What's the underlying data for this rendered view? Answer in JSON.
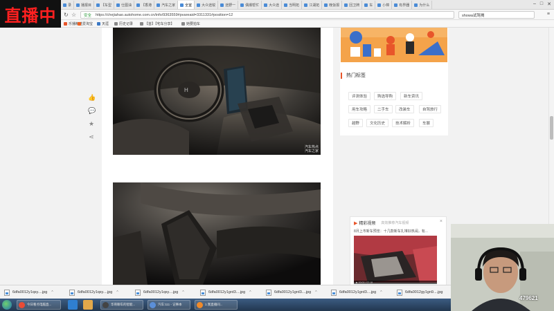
{
  "live_badge": "直播中",
  "browser": {
    "tabs": [
      "录",
      "播报目",
      "【车型",
      "仕图油",
      "【香港",
      "汽车之家",
      "全室",
      "大众途锐",
      "途野一",
      "偶爆帮忙",
      "大众途",
      "当明拓",
      "江湖拓",
      "晚饭报",
      "回卫牌",
      "车",
      "小棉",
      "有界器",
      "为什么"
    ],
    "active_tab_index": 6,
    "url": "https://chejiahao.autohome.com.cn/info/9363559#pvareaid=3311331#position=12",
    "secure_label": "安全",
    "search_text": "showa试驾揭",
    "bookmarks": [
      "乐播精选",
      "爱淘宝",
      "天涯",
      "历史记录",
      "【首】【宅车分享】",
      "她要拍车"
    ]
  },
  "share_rail": [
    {
      "icon": "thumbs-up-icon",
      "glyph": "👍"
    },
    {
      "icon": "comment-icon",
      "glyph": "💬"
    },
    {
      "icon": "star-icon",
      "glyph": "★"
    },
    {
      "icon": "share-icon",
      "glyph": "⋖"
    }
  ],
  "photo_watermark": "汽车热点\n汽车之家",
  "sidebar": {
    "hot_tags_title": "热门标签",
    "tags": [
      "评测体验",
      "购选导购",
      "新车资讯",
      "用车攻略",
      "二手车",
      "改装车",
      "自驾旅行",
      "越野",
      "文化历史",
      "技术解析",
      "车展"
    ]
  },
  "video": {
    "title": "精彩视频",
    "subtitle": "高效推荐汽车视频",
    "close": "×",
    "desc": "8月上市新车预览：十几款新车扎堆好热闹，有...",
    "time": "▶ 00:00 / 07:18"
  },
  "downloads": [
    "6dfa0012y1qsy....jpg",
    "6dfa0012y1qsy....jpg",
    "6dfa0012y1qsy....jpg",
    "6dfa0012y1grd3....jpg",
    "6dfa0012y1grd3....jpg",
    "6dfa0012y1grd3....jpg",
    "6dfa0012gy1gn9....jpg"
  ],
  "taskbar": {
    "buttons": [
      "今日看点电脑直...",
      "华哥聊车的智能...",
      "汽车:111 - 记事本",
      "1.我直播间..."
    ]
  },
  "webcam": {
    "counter": "479621"
  },
  "colors": {
    "accent": "#e8552a",
    "live_red": "#ff2020"
  }
}
